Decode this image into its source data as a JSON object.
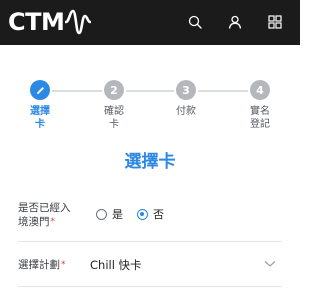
{
  "header": {
    "logo_text": "CTM",
    "icons": [
      "search-icon",
      "user-icon",
      "grid-menu-icon"
    ]
  },
  "stepper": {
    "steps": [
      {
        "number": "",
        "label": "選擇\n卡",
        "active": true
      },
      {
        "number": "2",
        "label": "確認\n卡",
        "active": false
      },
      {
        "number": "3",
        "label": "付款",
        "active": false
      },
      {
        "number": "4",
        "label": "實名\n登記",
        "active": false
      }
    ]
  },
  "page": {
    "title": "選擇卡"
  },
  "form": {
    "entered_macau": {
      "label": "是否已經入境澳門",
      "required_mark": "*",
      "options": [
        "是",
        "否"
      ],
      "selected": "否"
    },
    "plan": {
      "label": "選擇計劃",
      "required_mark": "*",
      "value": "Chill 快卡"
    }
  },
  "colors": {
    "header_bg": "#1b1b1b",
    "accent": "#2b88e5",
    "step_inactive": "#b4b8bd",
    "required": "#e23a3a"
  }
}
